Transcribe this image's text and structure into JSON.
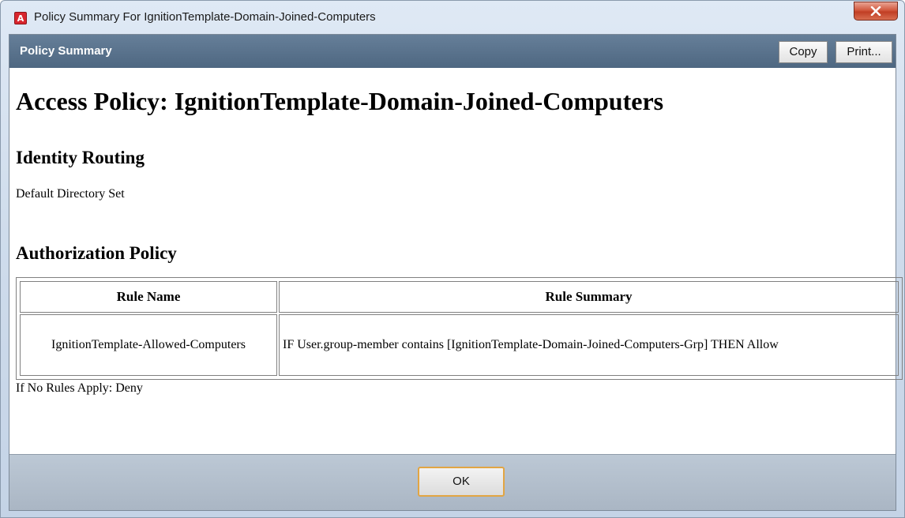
{
  "window": {
    "title": "Policy Summary For IgnitionTemplate-Domain-Joined-Computers",
    "app_icon_letter": "A",
    "app_icon_color": "#d8262e",
    "close_icon": "close-icon"
  },
  "header": {
    "title": "Policy Summary",
    "copy_label": "Copy",
    "print_label": "Print..."
  },
  "content": {
    "heading": "Access Policy: IgnitionTemplate-Domain-Joined-Computers",
    "identity_routing": {
      "heading": "Identity Routing",
      "value": "Default Directory Set"
    },
    "authorization": {
      "heading": "Authorization Policy",
      "columns": [
        "Rule Name",
        "Rule Summary"
      ],
      "rows": [
        {
          "name": "IgnitionTemplate-Allowed-Computers",
          "summary": "IF User.group-member contains [IgnitionTemplate-Domain-Joined-Computers-Grp] THEN Allow"
        }
      ],
      "default_rule": "If No Rules Apply: Deny"
    }
  },
  "footer": {
    "ok_label": "OK"
  },
  "colors": {
    "header_bar": "#566f89",
    "ok_focus_border": "#e2a543",
    "close_button": "#c13e24"
  }
}
